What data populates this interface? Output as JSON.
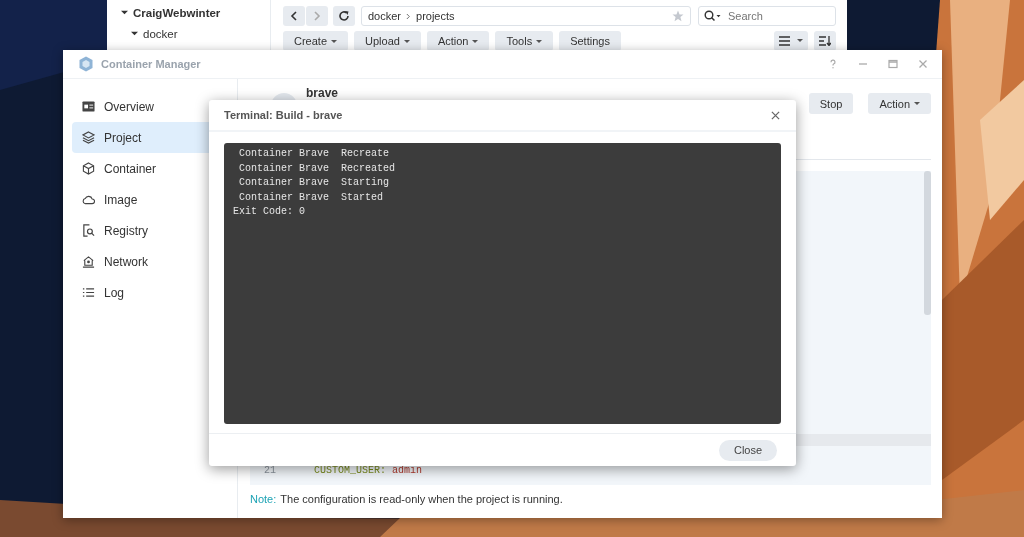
{
  "file_station": {
    "tree": [
      {
        "label": "CraigWebwinter",
        "expanded": true,
        "children": [
          {
            "label": "docker",
            "expanded": true
          }
        ]
      }
    ],
    "path": [
      "docker",
      "projects"
    ],
    "search": {
      "placeholder": "Search"
    },
    "toolbar": [
      {
        "label": "Create",
        "dropdown": true
      },
      {
        "label": "Upload",
        "dropdown": true
      },
      {
        "label": "Action",
        "dropdown": true
      },
      {
        "label": "Tools",
        "dropdown": true
      },
      {
        "label": "Settings",
        "dropdown": false
      }
    ]
  },
  "container_manager": {
    "window": {
      "title": "Container Manager"
    },
    "sidebar": {
      "items": [
        {
          "label": "Overview",
          "selected": false
        },
        {
          "label": "Project",
          "selected": true
        },
        {
          "label": "Container",
          "selected": false
        },
        {
          "label": "Image",
          "selected": false
        },
        {
          "label": "Registry",
          "selected": false
        },
        {
          "label": "Network",
          "selected": false
        },
        {
          "label": "Log",
          "selected": false
        }
      ]
    },
    "project": {
      "name": "brave",
      "buttons": [
        {
          "label": "Stop",
          "dropdown": false
        },
        {
          "label": "Action",
          "dropdown": true
        }
      ]
    },
    "code_lines": [
      {
        "number": "21",
        "key": "CUSTOM_USER:",
        "value": "admin"
      }
    ],
    "note": {
      "label": "Note:",
      "text": "The configuration is read-only when the project is running."
    }
  },
  "dialog": {
    "title": "Terminal: Build - brave",
    "terminal_lines": [
      " Container Brave  Recreate",
      " Container Brave  Recreated",
      " Container Brave  Starting",
      " Container Brave  Started",
      "Exit Code: 0"
    ],
    "buttons": [
      {
        "label": "Close"
      }
    ]
  }
}
